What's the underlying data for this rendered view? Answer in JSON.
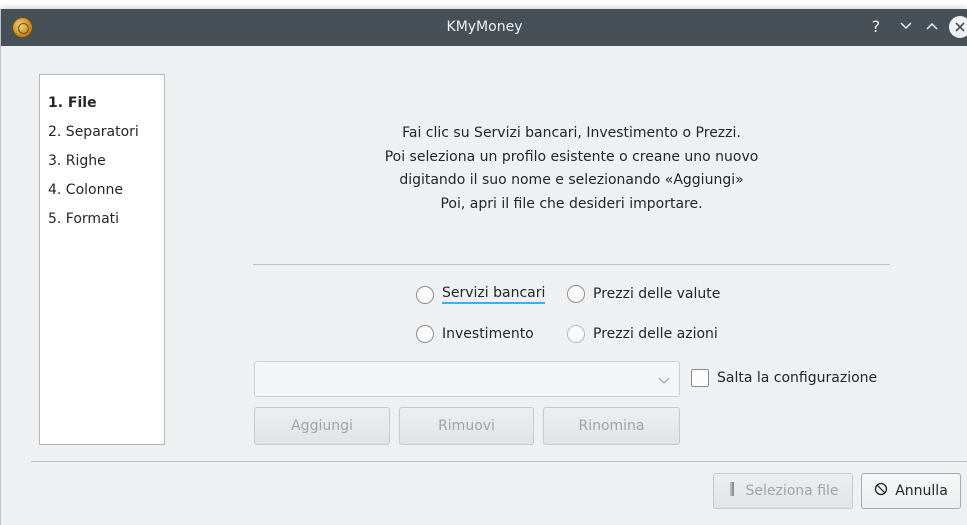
{
  "window": {
    "title": "KMyMoney",
    "icons": {
      "app": "kmymoney-coin-icon",
      "help": "help-icon",
      "minimize": "chevron-down-icon",
      "maximize": "chevron-up-icon",
      "close": "close-icon"
    }
  },
  "steps": [
    {
      "label": "1. File",
      "active": true
    },
    {
      "label": "2. Separatori",
      "active": false
    },
    {
      "label": "3. Righe",
      "active": false
    },
    {
      "label": "4. Colonne",
      "active": false
    },
    {
      "label": "5. Formati",
      "active": false
    }
  ],
  "instructions": [
    "Fai clic su Servizi bancari, Investimento o Prezzi.",
    "Poi seleziona un profilo esistente o creane uno nuovo",
    "digitando il suo nome e selezionando «Aggiungi»",
    "Poi, apri il file che desideri importare."
  ],
  "profile_types": {
    "banking": "Servizi bancari",
    "investment": "Investimento",
    "currency_prices": "Prezzi delle valute",
    "stock_prices": "Prezzi delle azioni"
  },
  "profile_combo": {
    "value": ""
  },
  "skip_setup": {
    "label": "Salta la configurazione",
    "checked": false
  },
  "profile_buttons": {
    "add": "Aggiungi",
    "remove": "Rimuovi",
    "rename": "Rinomina"
  },
  "footer": {
    "select_file": "Seleziona file",
    "cancel": "Annulla",
    "icons": {
      "select_file": "file-icon",
      "cancel": "cancel-circle-icon"
    }
  }
}
